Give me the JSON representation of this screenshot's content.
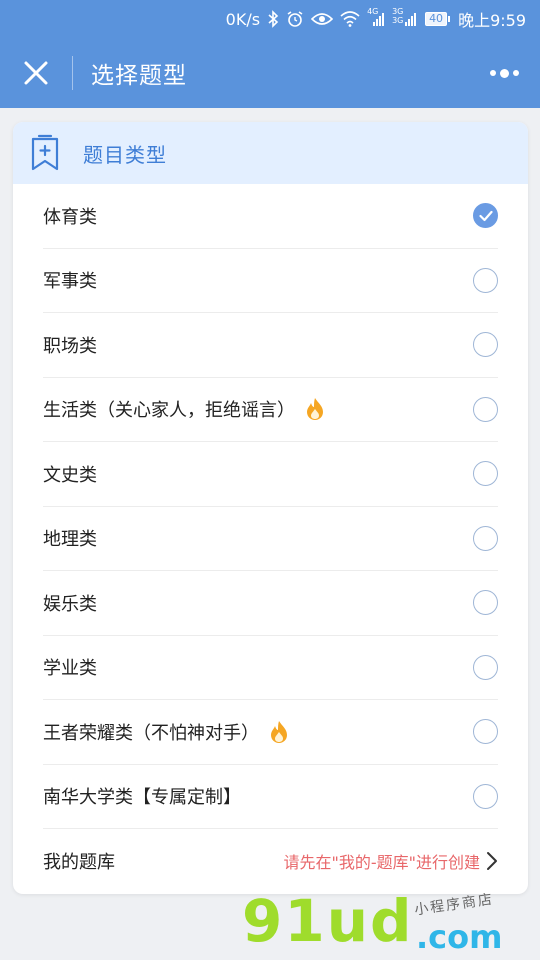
{
  "statusbar": {
    "speed": "0K/s",
    "net_4g": "4G",
    "net_3g_a": "3G",
    "net_3g_b": "3G",
    "battery": "40",
    "time": "晚上9:59"
  },
  "navbar": {
    "title": "选择题型"
  },
  "card": {
    "header_title": "题目类型",
    "options": [
      {
        "label": "体育类",
        "checked": true
      },
      {
        "label": "军事类",
        "checked": false
      },
      {
        "label": "职场类",
        "checked": false
      },
      {
        "label": "生活类（关心家人，拒绝谣言）",
        "checked": false,
        "hot": true
      },
      {
        "label": "文史类",
        "checked": false
      },
      {
        "label": "地理类",
        "checked": false
      },
      {
        "label": "娱乐类",
        "checked": false
      },
      {
        "label": "学业类",
        "checked": false
      },
      {
        "label": "王者荣耀类（不怕神对手）",
        "checked": false,
        "hot": true
      },
      {
        "label": "南华大学类【专属定制】",
        "checked": false
      }
    ],
    "my_bank": {
      "label": "我的题库",
      "hint": "请先在\"我的-题库\"进行创建"
    }
  },
  "watermark": {
    "brand": "91ud",
    "domain": ".com",
    "tagline": "小程序商店"
  },
  "colors": {
    "primary": "#5a93dc",
    "header_bg": "#e3efff",
    "check": "#6a9be3",
    "hint": "#e8676a",
    "flame": "#f5a623"
  }
}
